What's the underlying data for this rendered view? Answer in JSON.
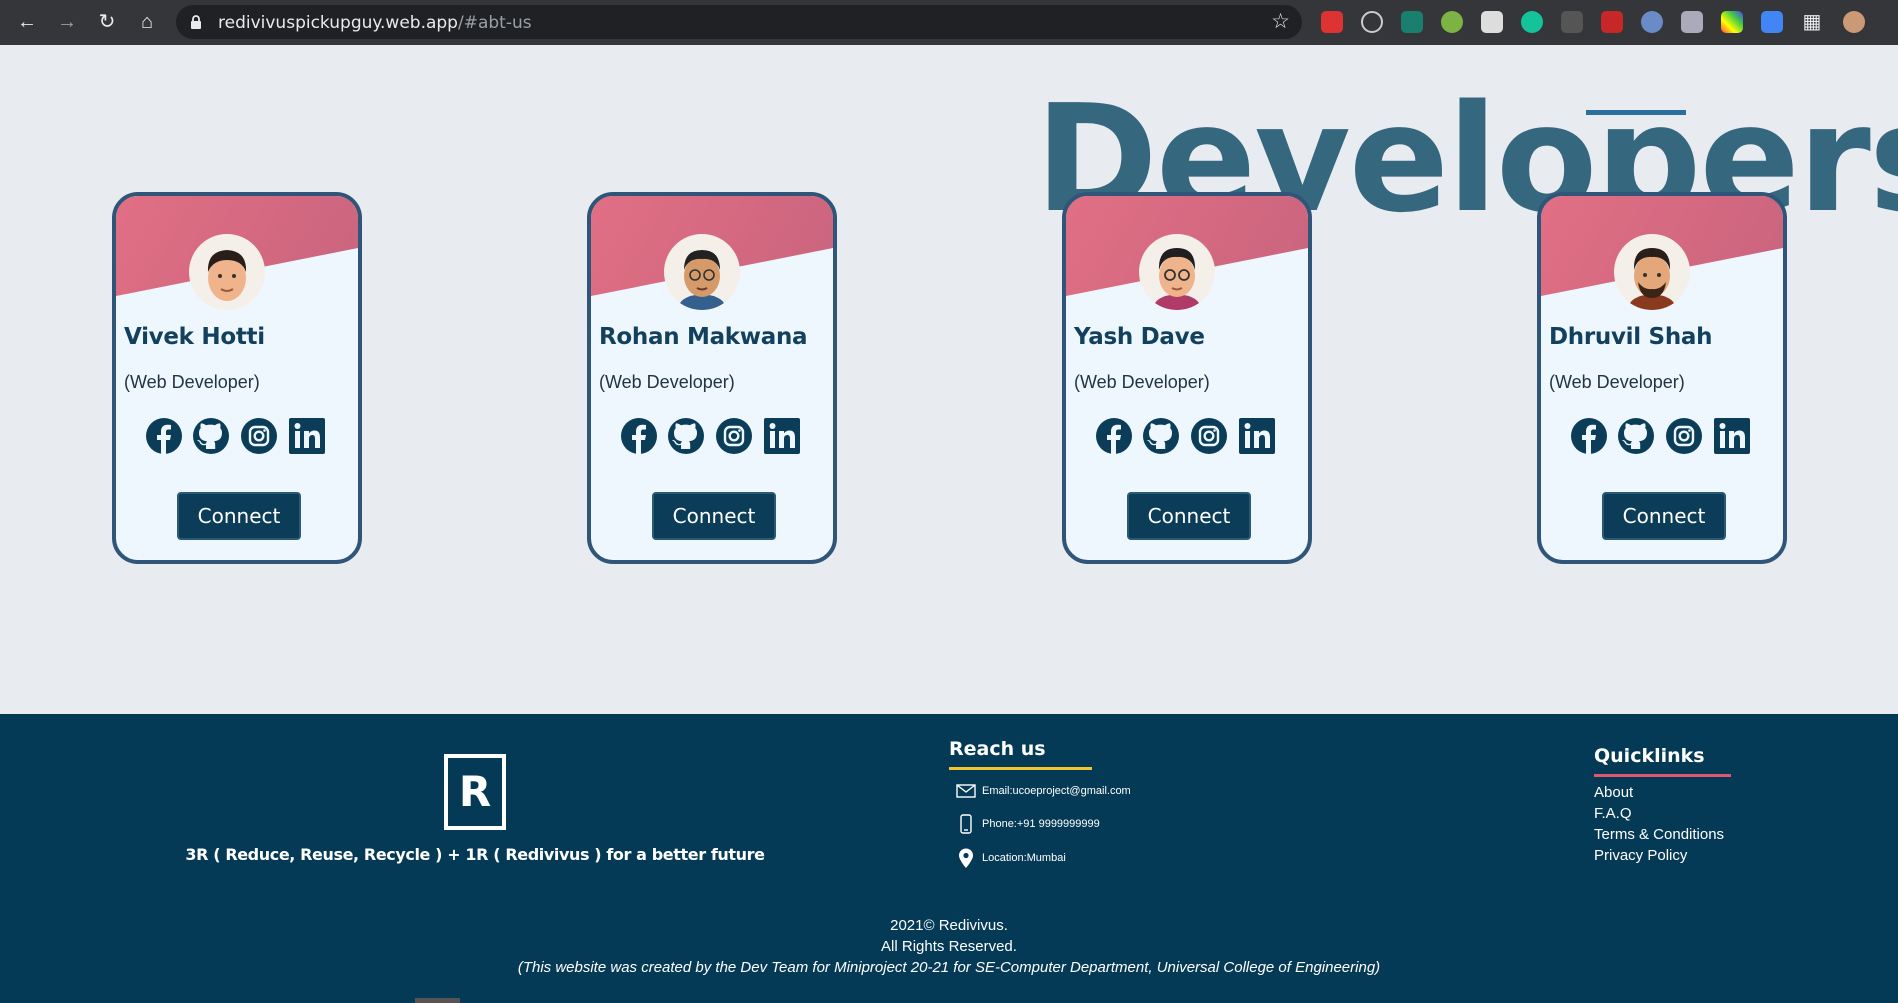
{
  "browser": {
    "url_host": "redivivuspickupguy.web.app",
    "url_path": "/#abt-us"
  },
  "section": {
    "title": "Developers"
  },
  "developers": [
    {
      "name": "Vivek Hotti",
      "role": "(Web Developer)",
      "connect_label": "Connect"
    },
    {
      "name": "Rohan Makwana",
      "role": "(Web Developer)",
      "connect_label": "Connect"
    },
    {
      "name": "Yash Dave",
      "role": "(Web Developer)",
      "connect_label": "Connect"
    },
    {
      "name": "Dhruvil Shah",
      "role": "(Web Developer)",
      "connect_label": "Connect"
    }
  ],
  "social_icons": [
    "facebook-icon",
    "github-icon",
    "instagram-icon",
    "linkedin-icon"
  ],
  "footer": {
    "logo_letter": "R",
    "tagline": "3R ( Reduce, Reuse, Recycle ) + 1R ( Redivivus ) for a better future",
    "reach_title": "Reach us",
    "email": "Email:ucoeproject@gmail.com",
    "phone": "Phone:+91 9999999999",
    "location": "Location:Mumbai",
    "quicklinks_title": "Quicklinks",
    "quicklinks": [
      "About",
      "F.A.Q",
      "Terms & Conditions",
      "Privacy Policy"
    ],
    "copyright": "2021© Redivivus.",
    "rights": "All Rights Reserved.",
    "credit": "(This website was created by the Dev Team for Miniproject 20-21 for SE-Computer Department, Universal College of Engineering)"
  },
  "colors": {
    "card_border": "#2f5578",
    "banner": "#e16f84",
    "footer_bg": "#053a56",
    "title": "#35677f",
    "reach_underline": "#f4c430",
    "quicklinks_underline": "#e0566f"
  }
}
